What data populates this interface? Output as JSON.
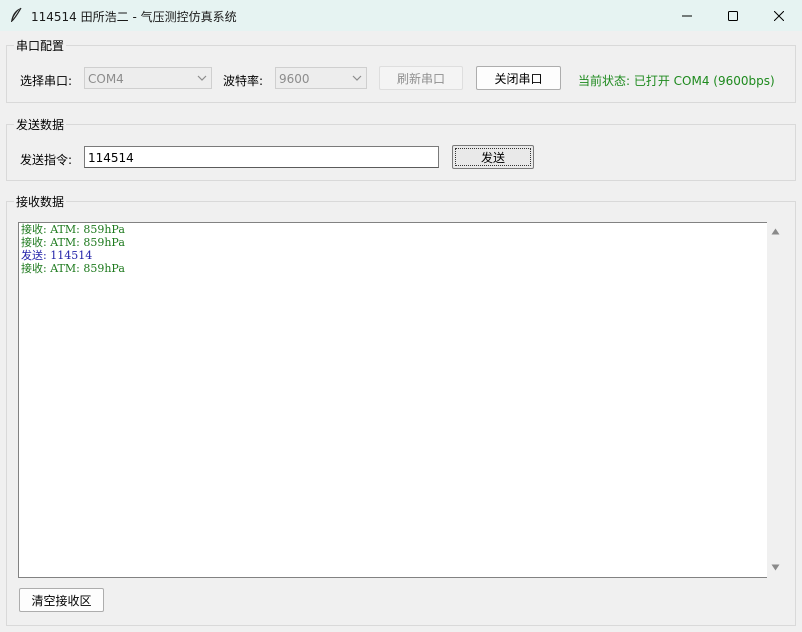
{
  "window": {
    "title": "114514 田所浩二 - 气压测控仿真系统",
    "icon": "feather-icon",
    "controls": [
      "minimize-icon",
      "maximize-icon",
      "close-icon"
    ]
  },
  "serial_config": {
    "group_title": "串口配置",
    "port_label": "选择串口:",
    "port_value": "COM4",
    "baud_label": "波特率:",
    "baud_value": "9600",
    "refresh_label": "刷新串口",
    "close_label": "关闭串口",
    "status_text": "当前状态: 已打开 COM4 (9600bps)"
  },
  "send": {
    "group_title": "发送数据",
    "command_label": "发送指令:",
    "command_value": "114514",
    "send_label": "发送"
  },
  "receive": {
    "group_title": "接收数据",
    "lines": [
      {
        "text": "接收: ATM: 859hPa",
        "color": "#1e7a1e"
      },
      {
        "text": "接收: ATM: 859hPa",
        "color": "#1e7a1e"
      },
      {
        "text": "发送: 114514",
        "color": "#1f1fa8"
      },
      {
        "text": "接收: ATM: 859hPa",
        "color": "#1e7a1e"
      }
    ],
    "clear_label": "清空接收区"
  },
  "colors": {
    "status_green": "#1e8a1e",
    "titlebar_bg": "#e6f3f2"
  }
}
